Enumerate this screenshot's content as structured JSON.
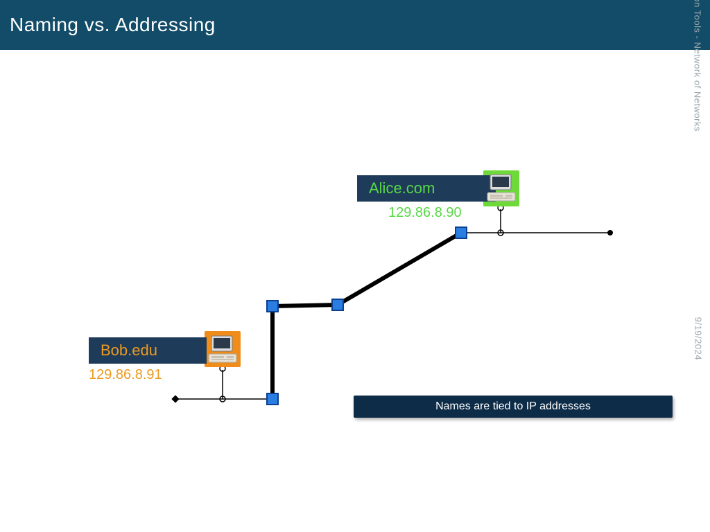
{
  "slide": {
    "title": "Naming vs. Addressing",
    "side_course": "Information Tools - Network of Networks",
    "side_date": "9/19/2024",
    "note": "Names are tied to IP addresses"
  },
  "hosts": {
    "alice": {
      "name": "Alice.com",
      "ip": "129.86.8.90"
    },
    "bob": {
      "name": "Bob.edu",
      "ip": "129.86.8.91"
    }
  }
}
